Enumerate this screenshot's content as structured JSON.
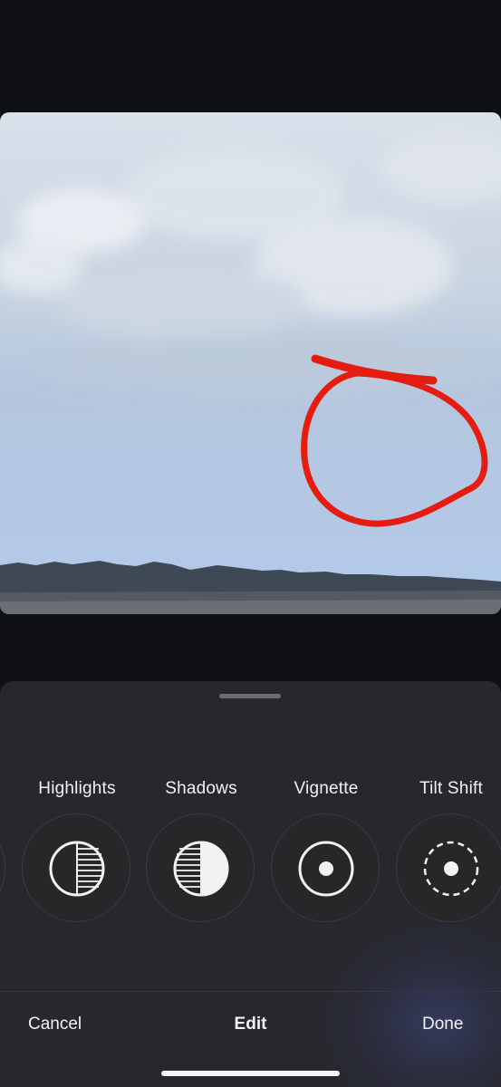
{
  "photo": {
    "annotation_color": "#e41d10",
    "sky_color": "#b3c9e6"
  },
  "adjustments": {
    "tools": [
      {
        "label": "Highlights",
        "icon": "highlights-icon"
      },
      {
        "label": "Shadows",
        "icon": "shadows-icon"
      },
      {
        "label": "Vignette",
        "icon": "vignette-icon"
      },
      {
        "label": "Tilt Shift",
        "icon": "tilt-shift-icon"
      }
    ]
  },
  "toolbar": {
    "cancel_label": "Cancel",
    "title": "Edit",
    "done_label": "Done"
  }
}
